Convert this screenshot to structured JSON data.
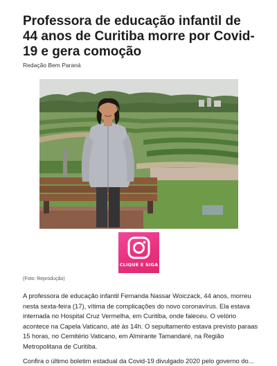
{
  "article": {
    "title": "Professora de educação infantil de 44 anos de Curitiba morre por Covid-19 e gera comoção",
    "byline": "Redação Bem Paraná",
    "photo_caption": "(Foto: Reprodução)",
    "body": "A professora de educação infantil Fernanda Nassar Woiczack, 44 anos, morreu nesta sexta-feira (17), vítima de complicações do novo coronavírus. Ela estava internada no Hospital Cruz Vermelha, em Curitiba, onde faleceu. O velório acontece na Capela Vaticano, até às 14h. O sepultamento estava previsto paraas 15 horas, no Cemitério Vaticano, em Almirante Tamandaré, na Região Metropolitana de Curitiba.",
    "body_next_partial": "Confira o último boletim estadual da Covid-19 divulgado 2020 pelo governo do..."
  },
  "instagram": {
    "cta_label": "CLIQUE E SIGA",
    "icon": "instagram-icon",
    "brand_color": "#e8317f"
  }
}
